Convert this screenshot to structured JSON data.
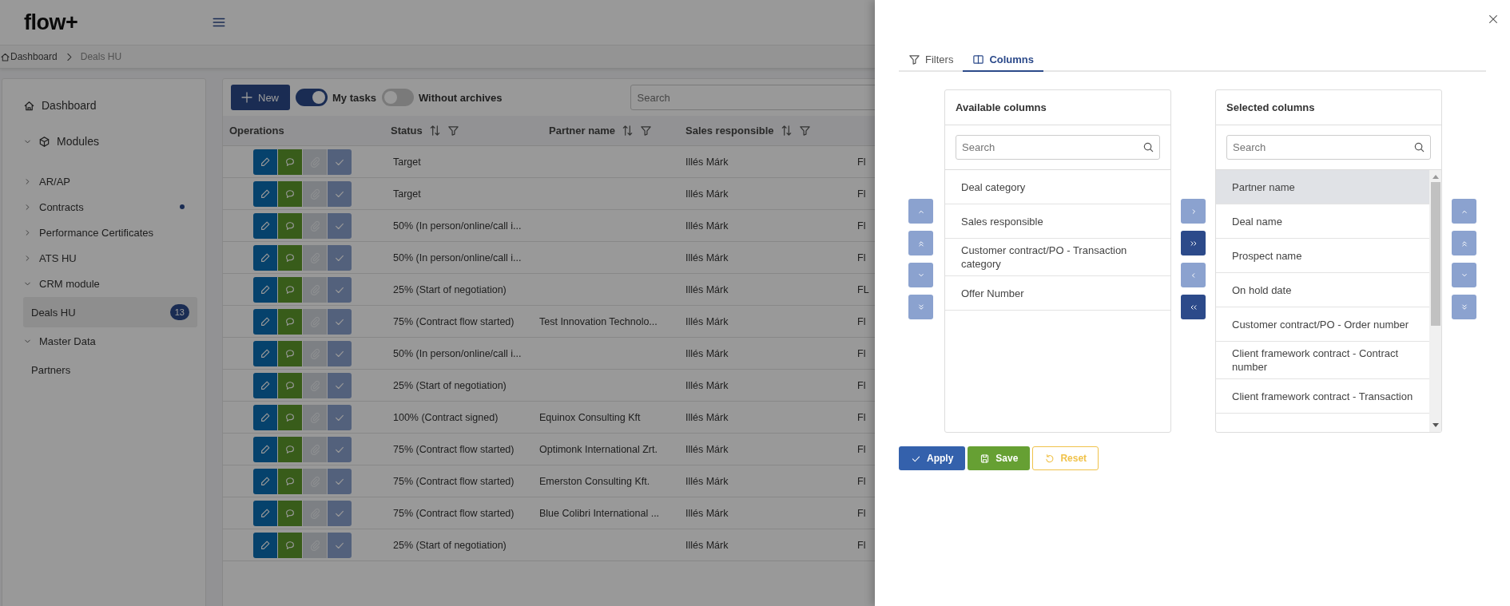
{
  "app": {
    "logo": "flow+"
  },
  "breadcrumb": [
    "Dashboard",
    "Deals HU"
  ],
  "sidebar": {
    "items": [
      {
        "kind": "home",
        "label": "Dashboard"
      },
      {
        "kind": "modules",
        "label": "Modules",
        "expanded": true,
        "children": [
          {
            "label": "AR/AP",
            "expanded": false,
            "dot": false
          },
          {
            "label": "Contracts",
            "expanded": false,
            "dot": true
          },
          {
            "label": "Performance Certificates",
            "expanded": false,
            "dot": false
          },
          {
            "label": "ATS HU",
            "expanded": false,
            "dot": false
          },
          {
            "label": "CRM module",
            "expanded": true,
            "dot": false,
            "children": [
              {
                "label": "Deals HU",
                "selected": true,
                "badge": "13"
              }
            ]
          },
          {
            "label": "Master Data",
            "expanded": true,
            "dot": false,
            "children": [
              {
                "label": "Partners",
                "selected": false
              }
            ]
          }
        ]
      }
    ]
  },
  "toolbar": {
    "new_button": "New",
    "toggles": [
      {
        "label": "My tasks",
        "on": true
      },
      {
        "label": "Without archives",
        "on": false
      }
    ],
    "search": {
      "placeholder": "Search"
    }
  },
  "table": {
    "columns": [
      {
        "label": "Operations",
        "sortable": false,
        "filterable": false
      },
      {
        "label": "Status",
        "sortable": true,
        "filterable": true
      },
      {
        "label": "Partner name",
        "sortable": true,
        "filterable": true
      },
      {
        "label": "Sales responsible",
        "sortable": true,
        "filterable": true
      }
    ],
    "operations": [
      {
        "kind": "edit",
        "disabled": false
      },
      {
        "kind": "comment",
        "disabled": false
      },
      {
        "kind": "attach",
        "disabled": true
      },
      {
        "kind": "approve",
        "disabled": false
      }
    ],
    "rows": [
      {
        "status": "Target",
        "partner": "",
        "sales": "Illés Márk",
        "column_4": "Fl"
      },
      {
        "status": "Target",
        "partner": "",
        "sales": "Illés Márk",
        "column_4": "Fl"
      },
      {
        "status": "50% (In person/online/call i...",
        "partner": "",
        "sales": "Illés Márk",
        "column_4": "Fl"
      },
      {
        "status": "50% (In person/online/call i...",
        "partner": "",
        "sales": "Illés Márk",
        "column_4": "Fl"
      },
      {
        "status": "25% (Start of negotiation)",
        "partner": "",
        "sales": "Illés Márk",
        "column_4": "FL"
      },
      {
        "status": "75% (Contract flow started)",
        "partner": "Test Innovation Technolo...",
        "sales": "Illés Márk",
        "column_4": "Fl"
      },
      {
        "status": "50% (In person/online/call i...",
        "partner": "",
        "sales": "Illés Márk",
        "column_4": "Fl"
      },
      {
        "status": "25% (Start of negotiation)",
        "partner": "",
        "sales": "Illés Márk",
        "column_4": "Fl"
      },
      {
        "status": "100% (Contract signed)",
        "partner": "Equinox Consulting Kft",
        "sales": "Illés Márk",
        "column_4": "Fl"
      },
      {
        "status": "75% (Contract flow started)",
        "partner": "Optimonk International Zrt.",
        "sales": "Illés Márk",
        "column_4": "Fl"
      },
      {
        "status": "75% (Contract flow started)",
        "partner": "Emerston Consulting Kft.",
        "sales": "Illés Márk",
        "column_4": "Fl"
      },
      {
        "status": "75% (Contract flow started)",
        "partner": "Blue Colibri International ...",
        "sales": "Illés Márk",
        "column_4": "Fl"
      },
      {
        "status": "25% (Start of negotiation)",
        "partner": "",
        "sales": "Illés Márk",
        "column_4": "Fl"
      }
    ]
  },
  "drawer": {
    "tabs": [
      {
        "kind": "filter",
        "label": "Filters",
        "selected": false
      },
      {
        "kind": "columns",
        "label": "Columns",
        "selected": true
      }
    ],
    "left_order_buttons": [
      {
        "kind": "up",
        "disabled": true
      },
      {
        "kind": "top",
        "disabled": true
      },
      {
        "kind": "down",
        "disabled": true
      },
      {
        "kind": "bottom",
        "disabled": true
      }
    ],
    "available": {
      "title": "Available columns",
      "search": {
        "placeholder": "Search"
      },
      "items": [
        {
          "label": "Deal category",
          "selected": false
        },
        {
          "label": "Sales responsible",
          "selected": false
        },
        {
          "label": "Customer contract/PO - Transaction category",
          "selected": false
        },
        {
          "label": "Offer Number",
          "selected": false
        }
      ]
    },
    "transfer_buttons": [
      {
        "kind": "right",
        "disabled": true
      },
      {
        "kind": "all-right",
        "disabled": false
      },
      {
        "kind": "left",
        "disabled": true
      },
      {
        "kind": "all-left",
        "disabled": false
      }
    ],
    "selected": {
      "title": "Selected columns",
      "search": {
        "placeholder": "Search"
      },
      "items": [
        {
          "label": "Partner name",
          "selected": true
        },
        {
          "label": "Deal name",
          "selected": false
        },
        {
          "label": "Prospect name",
          "selected": false
        },
        {
          "label": "On hold date",
          "selected": false
        },
        {
          "label": "Customer contract/PO - Order number",
          "selected": false
        },
        {
          "label": "Client framework contract - Contract number",
          "selected": false
        },
        {
          "label": "Client framework contract - Transaction",
          "selected": false
        }
      ]
    },
    "right_order_buttons": [
      {
        "kind": "up",
        "disabled": true
      },
      {
        "kind": "top",
        "disabled": true
      },
      {
        "kind": "down",
        "disabled": true
      },
      {
        "kind": "bottom",
        "disabled": true
      }
    ],
    "actions": [
      {
        "kind": "apply",
        "label": "Apply"
      },
      {
        "kind": "save",
        "label": "Save"
      },
      {
        "kind": "reset",
        "label": "Reset"
      }
    ]
  }
}
